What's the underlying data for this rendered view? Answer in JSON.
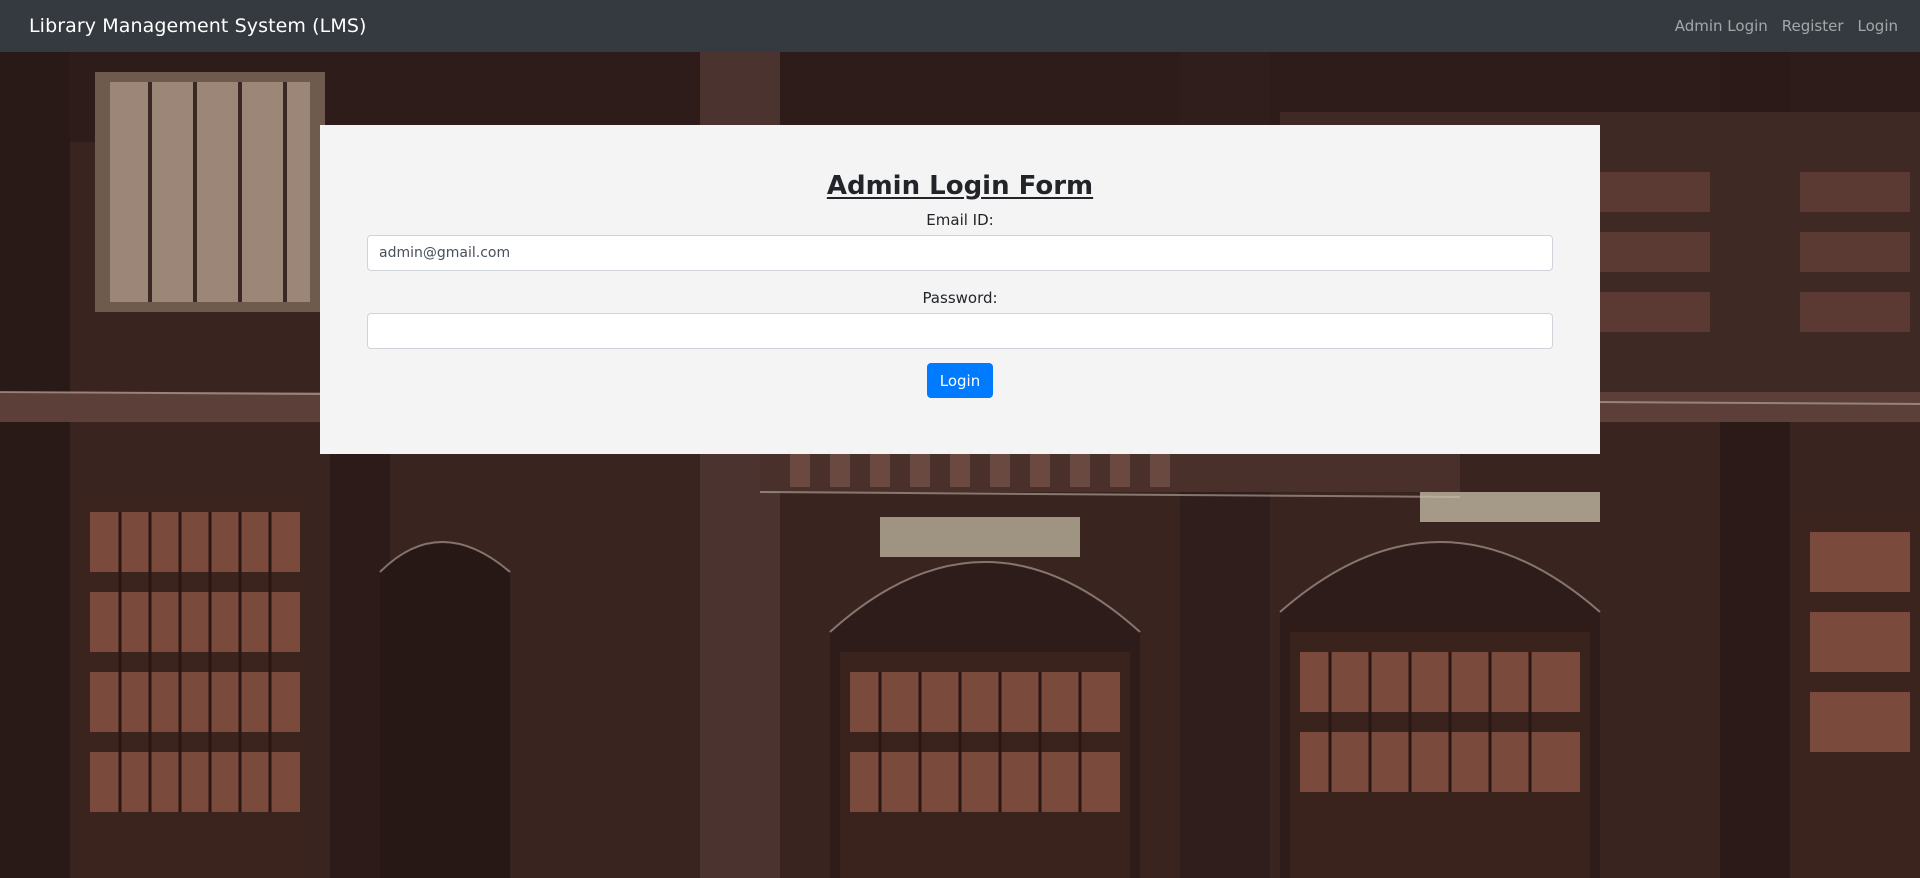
{
  "navbar": {
    "brand": "Library Management System (LMS)",
    "links": [
      "Admin Login",
      "Register",
      "Login"
    ]
  },
  "form": {
    "title": "Admin Login Form",
    "email_label": "Email ID:",
    "email_value": "admin@gmail.com",
    "password_label": "Password:",
    "password_value": "",
    "submit_label": "Login"
  },
  "colors": {
    "navbar_bg": "#343a40",
    "card_bg": "#f4f4f4",
    "button_bg": "#007bff"
  },
  "background": {
    "image": "library-bookshelves-painting"
  }
}
